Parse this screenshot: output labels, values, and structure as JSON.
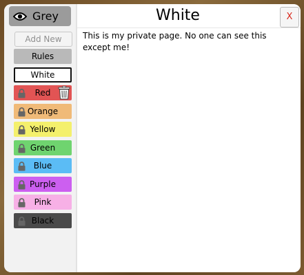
{
  "sidebar": {
    "owner_name": "Grey",
    "add_new_label": "Add New",
    "items": [
      {
        "label": "Rules",
        "color": "#b9b9b9",
        "locked": false
      },
      {
        "label": "White",
        "color": "#ffffff",
        "locked": false,
        "active": true
      },
      {
        "label": "Red",
        "color": "#e25454",
        "locked": true,
        "deletable": true
      },
      {
        "label": "Orange",
        "color": "#f0ba78",
        "locked": true
      },
      {
        "label": "Yellow",
        "color": "#f4f06c",
        "locked": true
      },
      {
        "label": "Green",
        "color": "#6fd46f",
        "locked": true
      },
      {
        "label": "Blue",
        "color": "#5bbcf5",
        "locked": true
      },
      {
        "label": "Purple",
        "color": "#cc5ff0",
        "locked": true
      },
      {
        "label": "Pink",
        "color": "#f7b0e6",
        "locked": true
      },
      {
        "label": "Black",
        "color": "#4a4a4a",
        "locked": true
      }
    ]
  },
  "page": {
    "title": "White",
    "close_label": "X",
    "content": "This is my private page. No one can see this except me!"
  }
}
